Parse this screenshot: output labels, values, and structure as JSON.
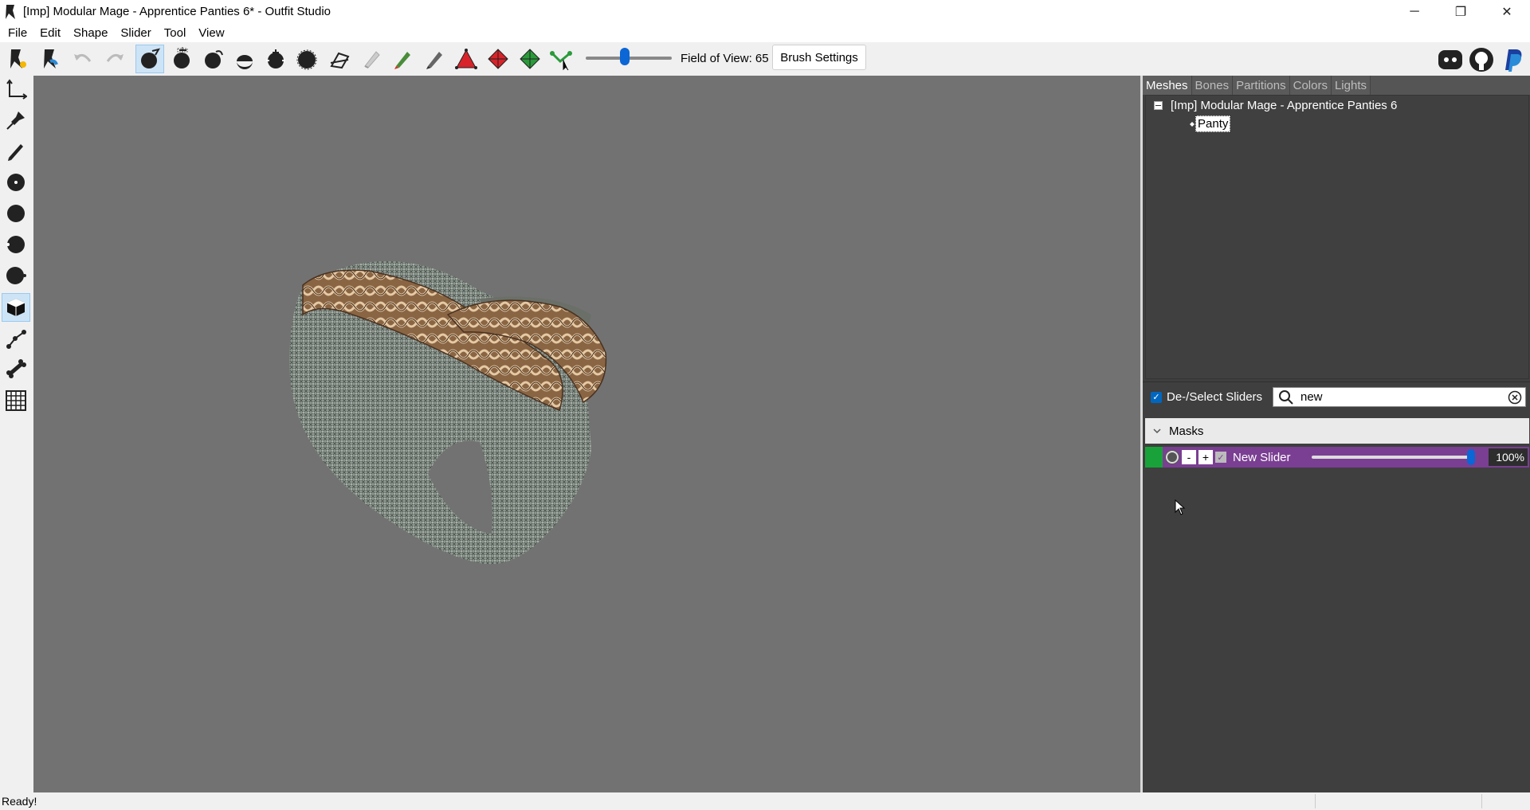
{
  "window": {
    "title": "[Imp] Modular Mage - Apprentice Panties 6* - Outfit Studio",
    "minimize_glyph": "─",
    "maximize_glyph": "❐",
    "close_glyph": "✕"
  },
  "menubar": [
    "File",
    "Edit",
    "Shape",
    "Slider",
    "Tool",
    "View"
  ],
  "toolbar": {
    "field_of_view_label": "Field of View: 65",
    "field_of_view_value": 65,
    "brush_settings_label": "Brush Settings",
    "tools": [
      "load-reference-icon",
      "load-outfit-icon",
      "undo-icon",
      "redo-icon",
      "mask-brush-icon",
      "inflate-brush-icon",
      "deflate-brush-icon",
      "move-brush-icon",
      "smooth-brush-icon",
      "transform-icon",
      "undiff-icon",
      "eraser-icon",
      "weight-brush-icon",
      "color-brush-icon",
      "alpha-brush-icon",
      "collapse-vertex-icon",
      "flip-edge-icon",
      "split-edge-icon",
      "select-icon"
    ],
    "right_icons": [
      "discord-icon",
      "github-icon",
      "paypal-icon"
    ]
  },
  "left_tools": [
    "transform-tool-icon",
    "pivot-tool-icon",
    "pen-tool-icon",
    "dot-small-icon",
    "dot-medium-icon",
    "dot-left-icon",
    "dot-right-icon",
    "cube-icon",
    "bone-add-icon",
    "bone-icon",
    "grid-icon"
  ],
  "right_panel": {
    "tabs": [
      "Meshes",
      "Bones",
      "Partitions",
      "Colors",
      "Lights"
    ],
    "active_tab": "Meshes",
    "tree": {
      "root": "[Imp] Modular Mage - Apprentice Panties 6",
      "child": "Panty"
    },
    "deselect_label": "De-/Select Sliders",
    "search_value": "new",
    "masks_label": "Masks",
    "slider": {
      "minus": "-",
      "plus": "+",
      "name": "New Slider",
      "value_label": "100%",
      "value": 100
    }
  },
  "status": {
    "text": "Ready!"
  },
  "colors": {
    "viewport": "#727272",
    "panel": "#3f3f3f",
    "slider_row": "#7a3f92",
    "accent": "#0b66d6"
  }
}
